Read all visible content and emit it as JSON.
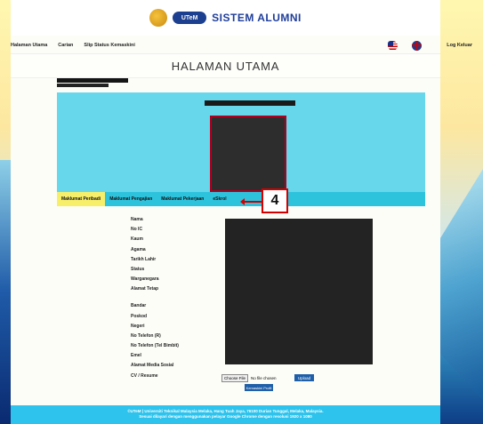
{
  "header": {
    "brand": "SISTEM ALUMNI",
    "utem_logo_text": "UTeM"
  },
  "nav": {
    "links": [
      "Halaman Utama",
      "Carian",
      "Slip Status Kemaskini"
    ],
    "logout": "Log Keluar",
    "flag_icons": [
      "malaysia-flag-icon",
      "uk-flag-icon"
    ]
  },
  "page": {
    "title": "HALAMAN UTAMA"
  },
  "tabs": [
    {
      "label": "Maklumat Peribadi",
      "active": true
    },
    {
      "label": "Maklumat Pengajian",
      "active": false
    },
    {
      "label": "Maklumat Pekerjaan",
      "active": false
    },
    {
      "label": "eSkrol",
      "active": false
    }
  ],
  "annotation": {
    "number": "4"
  },
  "fields": [
    "Nama",
    "No IC",
    "Kaum",
    "Agama",
    "Tarikh Lahir",
    "Status",
    "Warganegara",
    "Alamat Tetap",
    "Bandar",
    "Poskod",
    "Negeri",
    "No Telefon (R)",
    "No Telefon (Tel Bimbit)",
    "Emel",
    "Alamat Media Sosial",
    "CV / Resume"
  ],
  "cv": {
    "choose_file": "Choose File",
    "no_file": "No file chosen",
    "upload": "Upload",
    "update_profile": "Kemaskini Profil"
  },
  "footer": {
    "line1": "©UTeM | Universiti Teknikal Malaysia Melaka, Hang Tuah Jaya, 76100 Durian Tunggal, Melaka, Malaysia.",
    "line2": "Sesuai dilayari dengan menggunakan pelayar Google Chrome dengan resolusi 1920 x 1080"
  },
  "colors": {
    "profile_bg": "#67d7ec",
    "tab_bar": "#2ec3dd",
    "active_tab": "#f7ef6a",
    "annotation": "#d40000",
    "footer": "#2ec3ec"
  }
}
